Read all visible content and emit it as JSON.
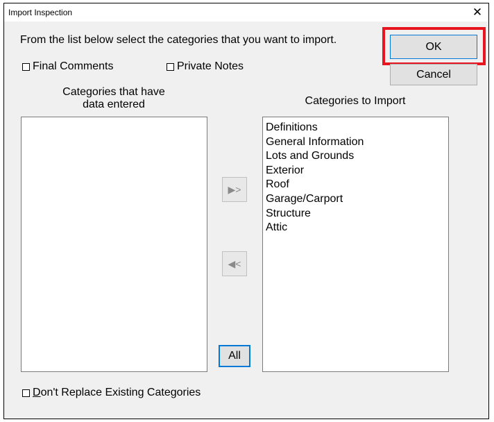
{
  "window": {
    "title": "Import Inspection",
    "close_glyph": "✕"
  },
  "instruction": "From the list below select the categories that you want to import.",
  "options": {
    "final_comments": "Final Comments",
    "private_notes": "Private Notes",
    "dont_replace_prefix": "D",
    "dont_replace_rest": "on't Replace Existing Categories"
  },
  "buttons": {
    "ok": "OK",
    "cancel": "Cancel",
    "all": "All",
    "add": "▶>",
    "remove": "◀<"
  },
  "left_list": {
    "caption_line1": "Categories that have",
    "caption_line2": "data entered",
    "items": []
  },
  "right_list": {
    "caption": "Categories to Import",
    "items": [
      "Definitions",
      "General Information",
      "Lots and Grounds",
      "Exterior",
      "Roof",
      "Garage/Carport",
      "Structure",
      "Attic"
    ]
  },
  "colors": {
    "highlight": "#e8141e",
    "dialog_bg": "#f0f0f0"
  }
}
